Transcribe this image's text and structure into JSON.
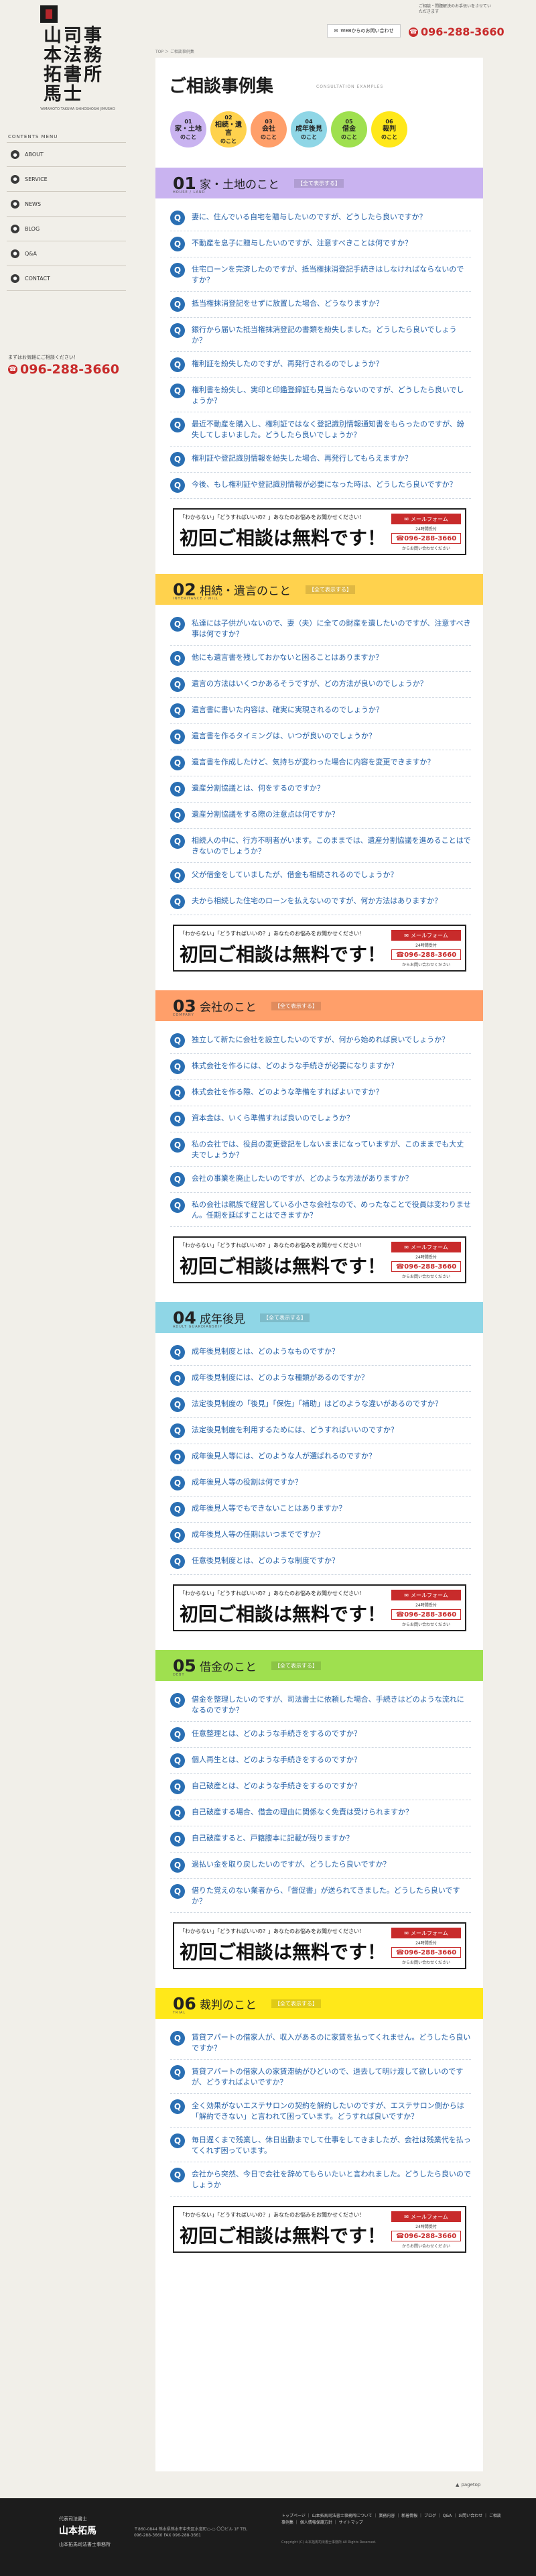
{
  "header": {
    "note": "ご相談・問題解決のお手伝いをさせていただきます",
    "mail_label": "WEBからのお問い合わせ",
    "tel": "096-288-3660"
  },
  "logo": {
    "col1": "山本拓馬",
    "col2": "司法書士",
    "col3": "事務所",
    "sub": "YAMAMOTO TAKUMA SHIHOSHOSHI JIMUSHO"
  },
  "sidebar": {
    "label": "CONTENTS MENU",
    "items": [
      {
        "label": "ABOUT"
      },
      {
        "label": "SERVICE"
      },
      {
        "label": "NEWS"
      },
      {
        "label": "BLOG"
      },
      {
        "label": "Q&A"
      },
      {
        "label": "CONTACT"
      }
    ],
    "tel_note": "まずはお気軽にご相談ください！",
    "tel": "096-288-3660"
  },
  "breadcrumb": "TOP ＞ ご相談事例集",
  "page": {
    "title": "ご相談事例集",
    "title_en": "CONSULTATION EXAMPLES"
  },
  "bubbles": [
    {
      "num": "01",
      "label": "家・土地",
      "suffix": "のこと",
      "color": "#c9b3f0"
    },
    {
      "num": "02",
      "label": "相続・遺言",
      "suffix": "のこと",
      "color": "#ffd24d"
    },
    {
      "num": "03",
      "label": "会社",
      "suffix": "のこと",
      "color": "#ff9f6a"
    },
    {
      "num": "04",
      "label": "成年後見",
      "suffix": "のこと",
      "color": "#8fd6e6"
    },
    {
      "num": "05",
      "label": "借金",
      "suffix": "のこと",
      "color": "#9fe04f"
    },
    {
      "num": "06",
      "label": "裁判",
      "suffix": "のこと",
      "color": "#ffe81a"
    }
  ],
  "all_label": "【全て表示する】",
  "sections": [
    {
      "num": "01",
      "title": "家・土地のこと",
      "en": "HOUSE / LAND",
      "color": "#c9b3f0",
      "questions": [
        "妻に、住んでいる自宅を贈与したいのですが、どうしたら良いですか？",
        "不動産を息子に贈与したいのですが、注意すべきことは何ですか？",
        "住宅ローンを完済したのですが、抵当権抹消登記手続きはしなければならないのですか？",
        "抵当権抹消登記をせずに放置した場合、どうなりますか？",
        "銀行から届いた抵当権抹消登記の書類を紛失しました。どうしたら良いでしょうか？",
        "権利証を紛失したのですが、再発行されるのでしょうか？",
        "権利書を紛失し、実印と印鑑登録証も見当たらないのですが、どうしたら良いでしょうか？",
        "最近不動産を購入し、権利証ではなく登記識別情報通知書をもらったのですが、紛失してしまいました。どうしたら良いでしょうか？",
        "権利証や登記識別情報を紛失した場合、再発行してもらえますか？",
        "今後、もし権利証や登記識別情報が必要になった時は、どうしたら良いですか？"
      ]
    },
    {
      "num": "02",
      "title": "相続・遺言のこと",
      "en": "INHERITANCE / WILL",
      "color": "#ffd24d",
      "questions": [
        "私達には子供がいないので、妻（夫）に全ての財産を遺したいのですが、注意すべき事は何ですか？",
        "他にも遺言書を残しておかないと困ることはありますか？",
        "遺言の方法はいくつかあるそうですが、どの方法が良いのでしょうか？",
        "遺言書に書いた内容は、確実に実現されるのでしょうか？",
        "遺言書を作るタイミングは、いつが良いのでしょうか？",
        "遺言書を作成したけど、気持ちが変わった場合に内容を変更できますか？",
        "遺産分割協議とは、何をするのですか？",
        "遺産分割協議をする際の注意点は何ですか？",
        "相続人の中に、行方不明者がいます。このままでは、遺産分割協議を進めることはできないのでしょうか？",
        "父が借金をしていましたが、借金も相続されるのでしょうか？",
        "夫から相続した住宅のローンを払えないのですが、何か方法はありますか？"
      ]
    },
    {
      "num": "03",
      "title": "会社のこと",
      "en": "COMPANY",
      "color": "#ff9f6a",
      "questions": [
        "独立して新たに会社を設立したいのですが、何から始めれば良いでしょうか？",
        "株式会社を作るには、どのような手続きが必要になりますか？",
        "株式会社を作る際、どのような準備をすればよいですか？",
        "資本金は、いくら準備すれば良いのでしょうか？",
        "私の会社では、役員の変更登記をしないままになっていますが、このままでも大丈夫でしょうか？",
        "会社の事業を廃止したいのですが、どのような方法がありますか？",
        "私の会社は親族で経営している小さな会社なので、めったなことで役員は変わりません。任期を延ばすことはできますか？"
      ]
    },
    {
      "num": "04",
      "title": "成年後見",
      "en": "ADULT GUARDIANSHIP",
      "color": "#8fd6e6",
      "questions": [
        "成年後見制度とは、どのようなものですか？",
        "成年後見制度には、どのような種類があるのですか？",
        "法定後見制度の「後見」「保佐」「補助」はどのような違いがあるのですか？",
        "法定後見制度を利用するためには、どうすればいいのですか？",
        "成年後見人等には、どのような人が選ばれるのですか？",
        "成年後見人等の役割は何ですか？",
        "成年後見人等でもできないことはありますか？",
        "成年後見人等の任期はいつまでですか？",
        "任意後見制度とは、どのような制度ですか？"
      ]
    },
    {
      "num": "05",
      "title": "借金のこと",
      "en": "DEBT",
      "color": "#9fe04f",
      "questions": [
        "借金を整理したいのですが、司法書士に依頼した場合、手続きはどのような流れになるのですか？",
        "任意整理とは、どのような手続きをするのですか？",
        "個人再生とは、どのような手続きをするのですか？",
        "自己破産とは、どのような手続きをするのですか？",
        "自己破産する場合、借金の理由に関係なく免責は受けられますか？",
        "自己破産すると、戸籍謄本に記載が残りますか？",
        "過払い金を取り戻したいのですが、どうしたら良いですか？",
        "借りた覚えのない業者から、「督促書」が送られてきました。どうしたら良いですか？"
      ]
    },
    {
      "num": "06",
      "title": "裁判のこと",
      "en": "TRIAL",
      "color": "#ffe81a",
      "questions": [
        "賃貸アパートの借家人が、収入があるのに家賃を払ってくれません。どうしたら良いですか？",
        "賃貸アパートの借家人の家賃滞納がひどいので、退去して明け渡して欲しいのですが、どうすればよいですか？",
        "全く効果がないエステサロンの契約を解約したいのですが、エステサロン側からは「解約できない」と言われて困っています。どうすれば良いですか？",
        "毎日遅くまで残業し、休日出勤までして仕事をしてきましたが、会社は残業代を払ってくれず困っています。",
        "会社から突然、今日で会社を辞めてもらいたいと言われました。どうしたら良いのでしょうか"
      ]
    }
  ],
  "banner": {
    "lead": "「わからない」「どうすればいいの？」あなたのお悩みをお聞かせください！",
    "main": "初回ご相談は無料です！",
    "mail": "メールフォーム",
    "hours": "24時間受付",
    "tel": "096-288-3660",
    "note": "からお問い合わせください"
  },
  "pagetop": "pagetop",
  "footer": {
    "role": "代表司法書士",
    "name": "山本拓馬",
    "office": "山本拓馬司法書士事務所",
    "address": "〒860-0844 熊本県熊本市中央区水道町○-○ 〇〇ビル 1F TEL 096-288-3660 FAX 096-288-3661",
    "links": "トップページ ｜ 山本拓馬司法書士事務所について ｜ 業務内容 ｜ 新着情報 ｜ ブログ ｜ Q&A ｜ お問い合わせ ｜ ご相談事例集 ｜ 個人情報保護方針 ｜ サイトマップ",
    "copy": "Copyright (C) 山本拓馬司法書士事務所 All Rights Reserved."
  }
}
